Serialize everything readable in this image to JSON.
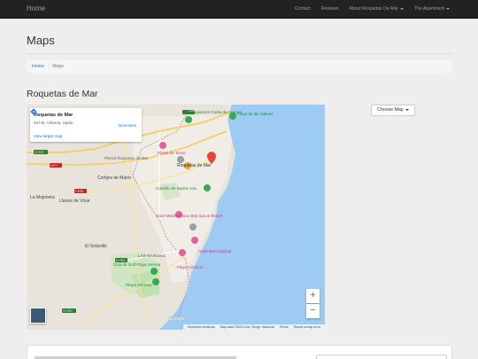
{
  "navbar": {
    "brand": "Home",
    "items": [
      {
        "label": "Contact",
        "dropdown": false
      },
      {
        "label": "Reviews",
        "dropdown": false
      },
      {
        "label": "About Roquetas De Mar",
        "dropdown": true
      },
      {
        "label": "The Apartment",
        "dropdown": true
      }
    ]
  },
  "page": {
    "title": "Maps"
  },
  "breadcrumb": {
    "home": "Home",
    "current": "Maps"
  },
  "section": {
    "title": "Roquetas de Mar"
  },
  "map": {
    "card": {
      "title": "Roquetas de Mar",
      "address": "04740, Almería, Spain",
      "larger_map": "View larger map",
      "directions": "Directions"
    },
    "labels": {
      "aquarium": "Aquarium Costa de Almería",
      "playa_salinas": "Playa de las Salinas",
      "plaza_toros": "Plaza de Toros",
      "pleniol": "Plenoil Roquetas de Mar",
      "roquetas": "Roquetas de Mar",
      "castillo": "Castillo de Santa Ana",
      "cortijos": "Cortijos de Marín",
      "mojonera": "La Mojonera",
      "llanos": "Llanos de Vícar",
      "hotel": "Hotel Mediterráneo Bay Spa & Resort",
      "solanillo": "El Solanillo",
      "marinas": "LAS MARINAS",
      "hotel_sabinal": "Hotel Best Sabinal",
      "playa_cerrillos": "Playa Cerrillos",
      "club_golf": "Club de Golf Playa Serena",
      "playa_serena": "Playa Serena",
      "road_a1051": "A-1051",
      "road_al9024": "AL-9024",
      "road_a7": "AUT-7",
      "road_a1050": "A-1050",
      "road_al3301": "AL-3301",
      "road_al3302": "AL-3302"
    },
    "zoom_in": "+",
    "zoom_out": "−",
    "google": "Google",
    "attribution": [
      "Keyboard shortcuts",
      "Map data ©2023 Inst. Geogr. Nacional",
      "Terms",
      "Report a map error"
    ]
  },
  "dropdown": {
    "label": "Choose Map"
  },
  "colors": {
    "navbar": "#222222",
    "link": "#337ab7",
    "sea": "#9ecbf2",
    "pin_green": "#34a853",
    "pin_pink": "#e55e9b"
  }
}
